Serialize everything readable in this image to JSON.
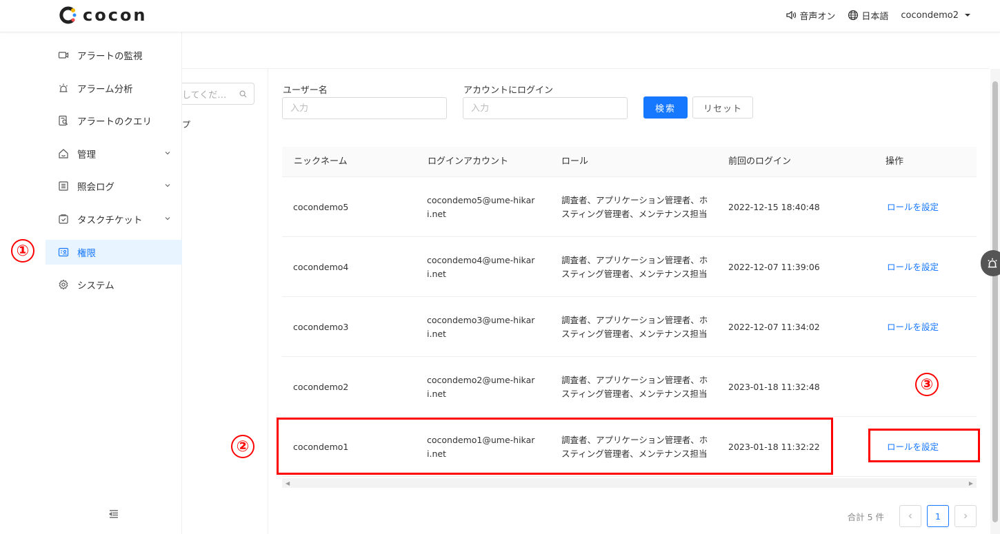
{
  "app": {
    "logo_text": "cocon"
  },
  "header": {
    "sound_label": "音声オン",
    "language_label": "日本語",
    "user_label": "cocondemo2"
  },
  "sidebar": {
    "items": [
      {
        "label": "アラートの監視",
        "icon": "video-icon"
      },
      {
        "label": "アラーム分析",
        "icon": "alarm-icon"
      },
      {
        "label": "アラートのクエリ",
        "icon": "query-icon"
      },
      {
        "label": "管理",
        "icon": "home-icon",
        "expandable": true
      },
      {
        "label": "照会ログ",
        "icon": "list-icon",
        "expandable": true
      },
      {
        "label": "タスクチケット",
        "icon": "ticket-icon",
        "expandable": true
      },
      {
        "label": "権限",
        "icon": "permission-icon",
        "active": true
      },
      {
        "label": "システム",
        "icon": "gear-icon"
      }
    ]
  },
  "tree": {
    "search_placeholder": "してくだ…",
    "fragment": "プ"
  },
  "search": {
    "username_label": "ユーザー名",
    "username_placeholder": "入力",
    "login_label": "アカウントにログイン",
    "login_placeholder": "入力",
    "search_button": "検索",
    "reset_button": "リセット"
  },
  "table": {
    "headers": [
      "ニックネーム",
      "ログインアカウント",
      "ロール",
      "前回のログイン",
      "操作"
    ],
    "rows": [
      {
        "nickname": "cocondemo5",
        "account": "cocondemo5@ume-hikari.net",
        "roles": "調査者、アプリケーション管理者、ホスティング管理者、メンテナンス担当",
        "last_login": "2022-12-15 18:40:48",
        "action": "ロールを設定"
      },
      {
        "nickname": "cocondemo4",
        "account": "cocondemo4@ume-hikari.net",
        "roles": "調査者、アプリケーション管理者、ホスティング管理者、メンテナンス担当",
        "last_login": "2022-12-07 11:39:06",
        "action": "ロールを設定"
      },
      {
        "nickname": "cocondemo3",
        "account": "cocondemo3@ume-hikari.net",
        "roles": "調査者、アプリケーション管理者、ホスティング管理者、メンテナンス担当",
        "last_login": "2022-12-07 11:34:02",
        "action": "ロールを設定"
      },
      {
        "nickname": "cocondemo2",
        "account": "cocondemo2@ume-hikari.net",
        "roles": "調査者、アプリケーション管理者、ホスティング管理者、メンテナンス担当",
        "last_login": "2023-01-18 11:32:48",
        "action": ""
      },
      {
        "nickname": "cocondemo1",
        "account": "cocondemo1@ume-hikari.net",
        "roles": "調査者、アプリケーション管理者、ホスティング管理者、メンテナンス担当",
        "last_login": "2023-01-18 11:32:22",
        "action": "ロールを設定"
      }
    ]
  },
  "pagination": {
    "total_label": "合計 5 件",
    "current_page": "1"
  },
  "annotations": [
    "①",
    "②",
    "③"
  ],
  "colors": {
    "accent": "#1677ff",
    "annotation": "#ff0000",
    "active_bg": "#e8f4ff"
  }
}
